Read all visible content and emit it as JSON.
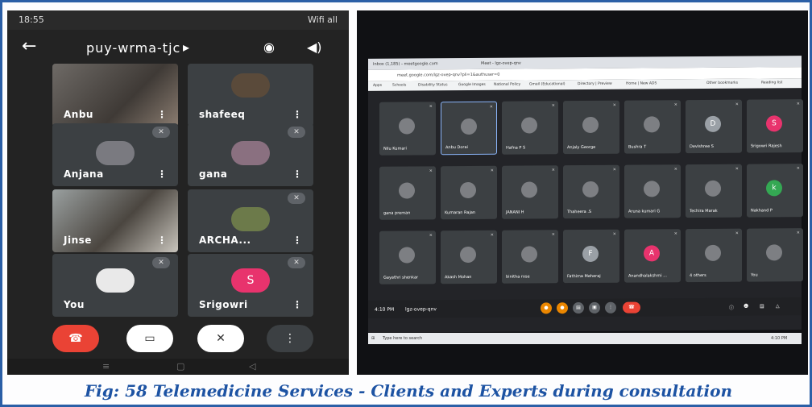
{
  "phone": {
    "status_time": "18:55",
    "status_right": "Wifi all",
    "meeting_code": "puy-wrma-tjc",
    "participants": [
      {
        "name": "Anbu",
        "muted": false
      },
      {
        "name": "shafeeq",
        "muted": false
      },
      {
        "name": "Anjana",
        "muted": true
      },
      {
        "name": "gana",
        "muted": true
      },
      {
        "name": "Jinse",
        "muted": false
      },
      {
        "name": "ARCHA...",
        "muted": true
      },
      {
        "name": "You",
        "muted": true
      },
      {
        "name": "Srigowri",
        "muted": true,
        "initial": "S"
      }
    ],
    "more_glyph": "⋮"
  },
  "laptop": {
    "tab1": "Inbox (1,185) - meetgoogle.com",
    "tab2": "Meet - lgz-ovep-qnv",
    "url": "meet.google.com/lgz-ovep-qnv?pli=1&authuser=0",
    "bookmarks": [
      "Apps",
      "Schools",
      "Disability Status",
      "Google Images",
      "National Policy",
      "Gmail (Educational)",
      "Directory | Preview",
      "Home | New ADS",
      "Other bookmarks",
      "Reading list"
    ],
    "participants": [
      {
        "name": "Nilu Kumari"
      },
      {
        "name": "Anbu Dorai"
      },
      {
        "name": "Hafna P S"
      },
      {
        "name": "Anjaly George"
      },
      {
        "name": "Bushra T"
      },
      {
        "name": "Devishree S",
        "initial": "D"
      },
      {
        "name": "Srigowri Rajesh",
        "initial": "S"
      },
      {
        "name": "gana preman"
      },
      {
        "name": "Kumaran Rajan"
      },
      {
        "name": "JANANI H"
      },
      {
        "name": "Thaheera .S"
      },
      {
        "name": "Aruna kumari G"
      },
      {
        "name": "Techira Marak"
      },
      {
        "name": "Nakhand P",
        "initial": "k"
      },
      {
        "name": "Gayathri shenkar"
      },
      {
        "name": "Akash Mohan"
      },
      {
        "name": "binitha rose"
      },
      {
        "name": "Fathima Meheraj",
        "initial": "F"
      },
      {
        "name": "Anandhalakshmi ...",
        "initial": "A"
      },
      {
        "name": "4 others"
      },
      {
        "name": "You"
      }
    ],
    "meeting_time": "4:10 PM",
    "meeting_code": "lgz-ovep-qnv",
    "search_placeholder": "Type here to search",
    "clock": "4:10 PM"
  },
  "caption": "Fig: 58   Telemedicine Services - Clients and Experts during consultation",
  "colors": {
    "frame": "#2b5fa6",
    "caption": "#1d53a3",
    "end_call": "#ea4335",
    "avatar_pink": "#e8336d",
    "meet_bg": "#202124",
    "tile": "#3c4043"
  }
}
